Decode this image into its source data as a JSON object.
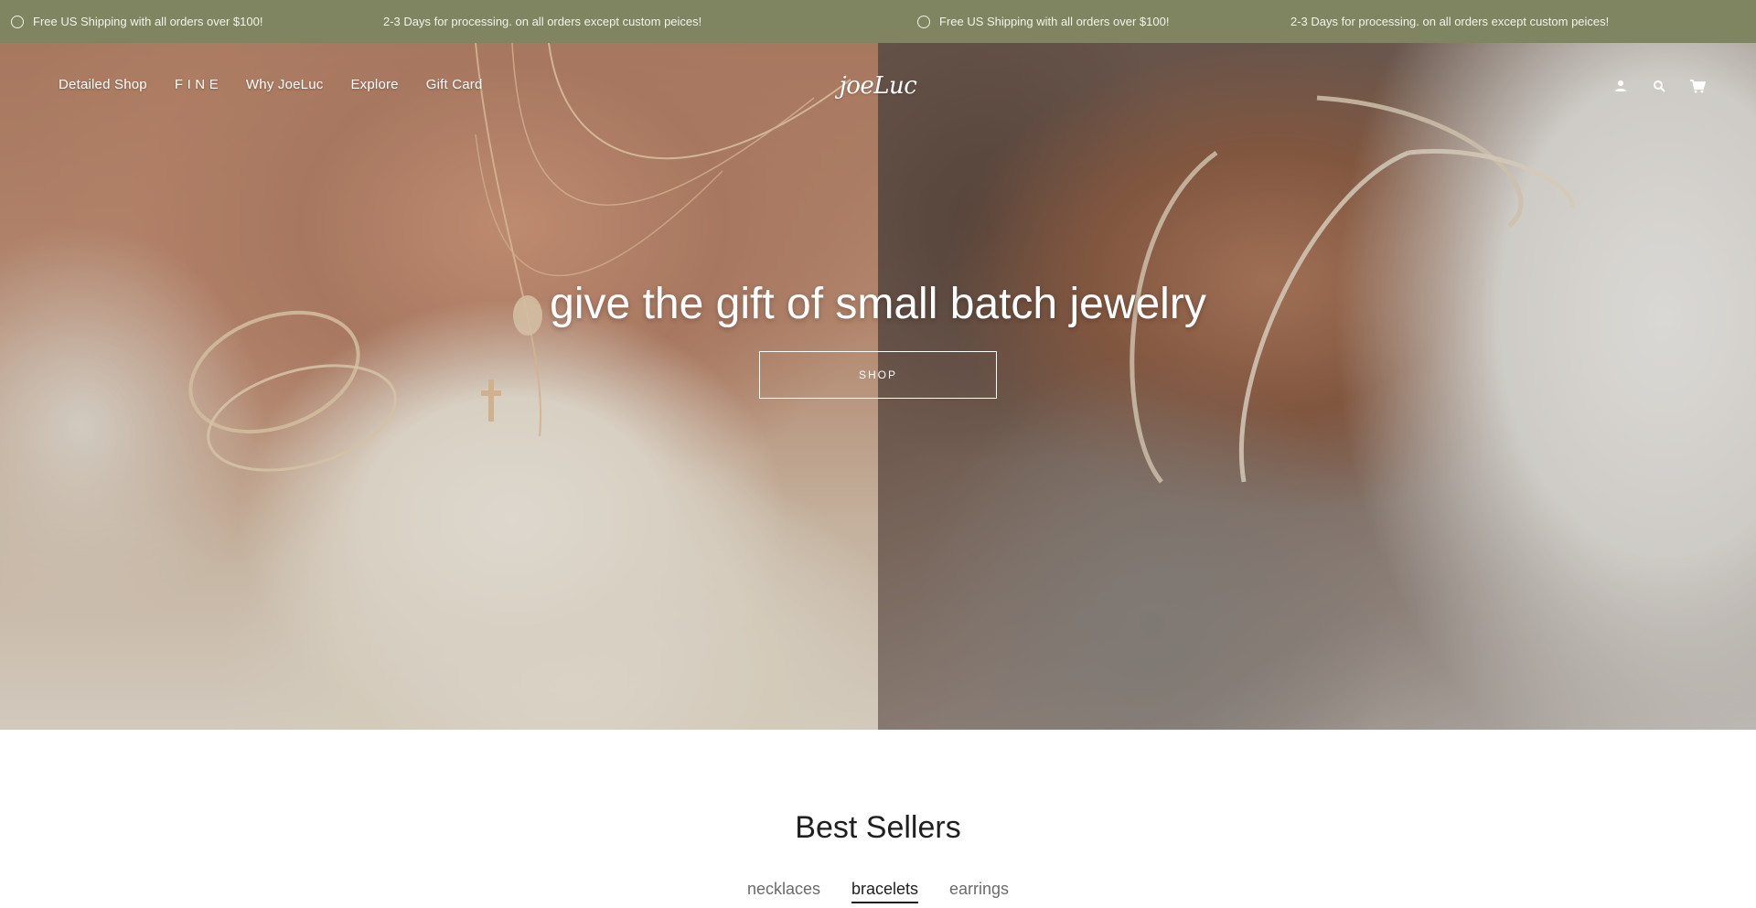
{
  "announcement": {
    "items": [
      "Free US Shipping with all orders over $100!",
      "2-3 Days for processing. on all orders except custom peices!",
      "Free US Shipping with all orders over $100!",
      "2-3 Days for processing. on all orders except custom peices!"
    ]
  },
  "header": {
    "nav": [
      "Detailed Shop",
      "F I N E",
      "Why JoeLuc",
      "Explore",
      "Gift Card"
    ],
    "logo_text": "joeLuc",
    "icons": [
      "account-icon",
      "search-icon",
      "cart-icon"
    ]
  },
  "hero": {
    "title": "give the gift of small batch jewelry",
    "button_label": "SHOP"
  },
  "best_sellers": {
    "title": "Best Sellers",
    "tabs": [
      "necklaces",
      "bracelets",
      "earrings"
    ],
    "active_tab": "bracelets"
  },
  "colors": {
    "announcement_bg": "#7f8561",
    "text_dark": "#1f1f1f",
    "white": "#ffffff"
  }
}
